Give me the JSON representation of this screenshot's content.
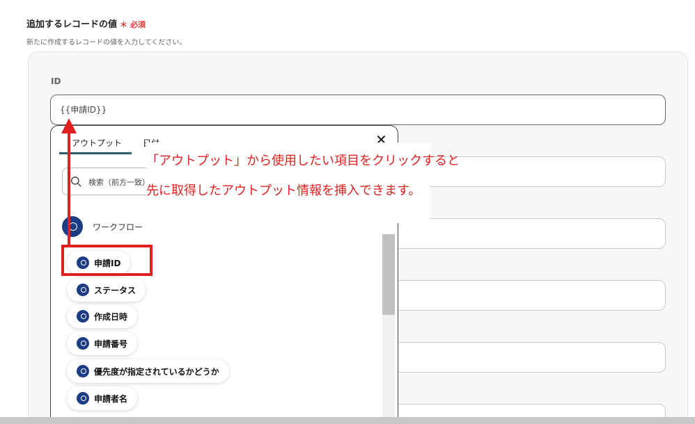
{
  "section": {
    "title": "追加するレコードの値",
    "required": "必須",
    "description": "新たに作成するレコードの値を入力してください。"
  },
  "field": {
    "label": "ID",
    "value": "{{申請ID}}"
  },
  "dropdown": {
    "tabs": [
      "アウトプット",
      "日付"
    ],
    "close": "✕",
    "search_placeholder": "検索（前方一致）",
    "group_label": "ワークフロー",
    "items": [
      "申請ID",
      "ステータス",
      "作成日時",
      "申請番号",
      "優先度が指定されているかどうか",
      "申請者名"
    ]
  },
  "callout": {
    "line1": "「アウトプット」から使用したい項目をクリックすると",
    "line2": "先に取得したアウトプット情報を挿入できます。"
  },
  "colors": {
    "accent": "#e02020",
    "brand": "#1c3c84",
    "tab_underline": "#2a5f6d"
  }
}
